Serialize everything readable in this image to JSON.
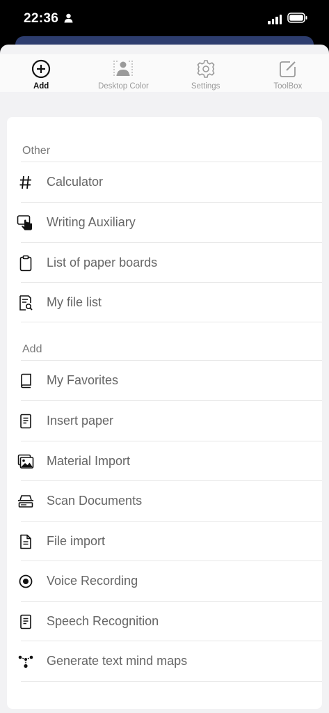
{
  "status_bar": {
    "time": "22:36"
  },
  "tabs": [
    {
      "label": "Add",
      "icon": "add-circle-icon",
      "active": true
    },
    {
      "label": "Desktop Color",
      "icon": "desktop-color-icon",
      "active": false
    },
    {
      "label": "Settings",
      "icon": "gear-icon",
      "active": false
    },
    {
      "label": "ToolBox",
      "icon": "edit-square-icon",
      "active": false
    }
  ],
  "sections": {
    "other": {
      "title": "Other",
      "items": [
        {
          "label": "Calculator",
          "icon": "hash-icon"
        },
        {
          "label": "Writing Auxiliary",
          "icon": "hand-pointer-icon"
        },
        {
          "label": "List of paper boards",
          "icon": "clipboard-icon"
        },
        {
          "label": "My file list",
          "icon": "file-search-icon"
        }
      ]
    },
    "add": {
      "title": "Add",
      "items": [
        {
          "label": "My Favorites",
          "icon": "book-icon"
        },
        {
          "label": "Insert paper",
          "icon": "document-icon"
        },
        {
          "label": "Material Import",
          "icon": "image-icon"
        },
        {
          "label": "Scan Documents",
          "icon": "scanner-icon"
        },
        {
          "label": "File import",
          "icon": "file-icon"
        },
        {
          "label": "Voice Recording",
          "icon": "record-icon"
        },
        {
          "label": "Speech Recognition",
          "icon": "document-lines-icon"
        },
        {
          "label": "Generate text mind maps",
          "icon": "mind-map-icon"
        }
      ]
    }
  },
  "colors": {
    "status_bar_bg": "#000000",
    "sheet_bg": "#f2f2f4",
    "card_bg": "#ffffff",
    "active_tab_text": "#111111",
    "inactive_tab_text": "#9a9a9a",
    "behind_sheet": "#2d3d6e"
  }
}
